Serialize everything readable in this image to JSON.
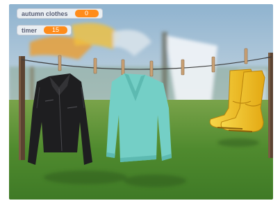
{
  "variables": [
    {
      "label": "autumn clothes",
      "value": "0"
    },
    {
      "label": "timer",
      "value": "15"
    }
  ],
  "sprites": [
    "leather-jacket",
    "teal-sweater",
    "yellow-rain-boots"
  ],
  "colors": {
    "monitor_value": "#ff8c1a",
    "monitor_bg": "#e9eef2",
    "sky": "#a9c3d6",
    "grass": "#5f8f3a",
    "sweater": "#74cfc6",
    "boots": "#f2c31f"
  }
}
